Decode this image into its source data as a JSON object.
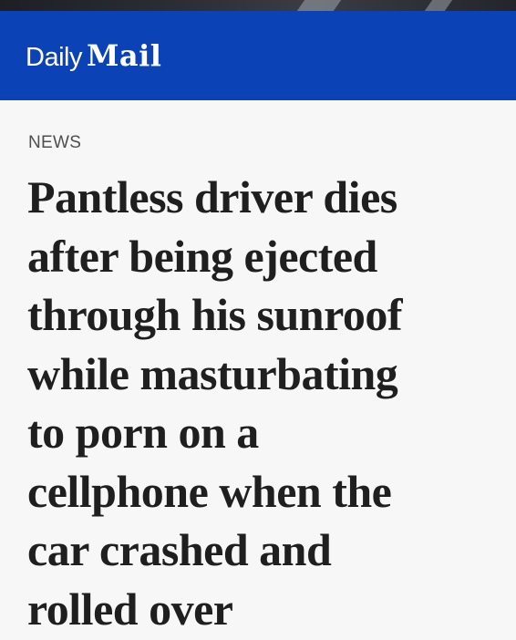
{
  "brand": {
    "logo_daily": "Daily",
    "logo_mail": "Mail",
    "header_color": "#0b43b7"
  },
  "article": {
    "section": "NEWS",
    "headline_lines": [
      "Pantless driver dies",
      "after being ejected",
      "through his sunroof",
      "while masturbating",
      "to porn on a",
      "cellphone when the",
      "car crashed and",
      "rolled over"
    ]
  }
}
